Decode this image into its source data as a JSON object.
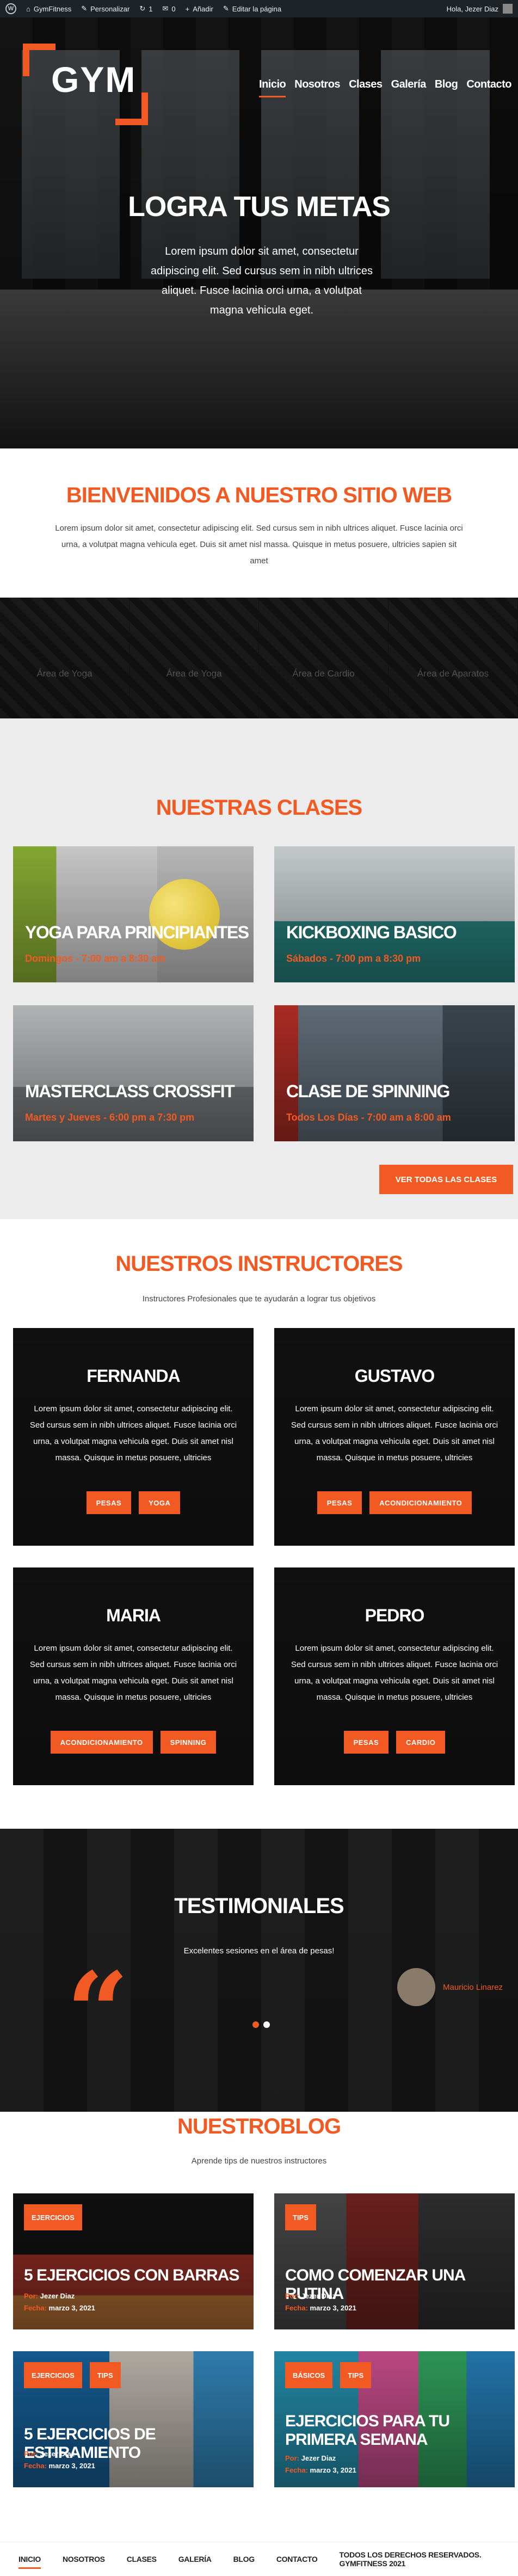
{
  "adminbar": {
    "site": "GymFitness",
    "customize": "Personalizar",
    "updates": "1",
    "comments": "0",
    "new": "Añadir",
    "edit": "Editar la página",
    "greeting": "Hola, Jezer Diaz"
  },
  "logo": {
    "text": "GYM"
  },
  "nav": [
    "Inicio",
    "Nosotros",
    "Clases",
    "Galería",
    "Blog",
    "Contacto"
  ],
  "hero": {
    "title": "LOGRA TUS METAS",
    "text": "Lorem ipsum dolor sit amet, consectetur adipiscing elit. Sed cursus sem in nibh ultrices aliquet. Fusce lacinia orci urna, a volutpat magna vehicula eget."
  },
  "welcome": {
    "title": "BIENVENIDOS A NUESTRO SITIO WEB",
    "text": "Lorem ipsum dolor sit amet, consectetur adipiscing elit. Sed cursus sem in nibh ultrices aliquet. Fusce lacinia orci urna, a volutpat magna vehicula eget. Duis sit amet nisl massa. Quisque in metus posuere, ultricies sapien sit amet"
  },
  "areas": [
    "Área de Yoga",
    "Área de Yoga",
    "Área de Cardio",
    "Área de Aparatos"
  ],
  "classes": {
    "title": "NUESTRAS CLASES",
    "items": [
      {
        "name": "YOGA PARA PRINCIPIANTES",
        "schedule": "Domingos - 7:00 am a 8:30 am"
      },
      {
        "name": "KICKBOXING BASICO",
        "schedule": "Sábados - 7:00 pm a 8:30 pm"
      },
      {
        "name": "MASTERCLASS CROSSFIT",
        "schedule": "Martes y Jueves - 6:00 pm a 7:30 pm"
      },
      {
        "name": "CLASE DE SPINNING",
        "schedule": "Todos Los Días - 7:00 am a 8:00 am"
      }
    ],
    "button": "VER TODAS LAS CLASES"
  },
  "instructors": {
    "title": "NUESTROS INSTRUCTORES",
    "subtitle": "Instructores Profesionales que te ayudarán a lograr tus objetivos",
    "items": [
      {
        "name": "FERNANDA",
        "text": "Lorem ipsum dolor sit amet, consectetur adipiscing elit. Sed cursus sem in nibh ultrices aliquet. Fusce lacinia orci urna, a volutpat magna vehicula eget. Duis sit amet nisl massa. Quisque in metus posuere, ultricies",
        "tags": [
          "PESAS",
          "YOGA"
        ]
      },
      {
        "name": "GUSTAVO",
        "text": "Lorem ipsum dolor sit amet, consectetur adipiscing elit. Sed cursus sem in nibh ultrices aliquet. Fusce lacinia orci urna, a volutpat magna vehicula eget. Duis sit amet nisl massa. Quisque in metus posuere, ultricies",
        "tags": [
          "PESAS",
          "ACONDICIONAMIENTO"
        ]
      },
      {
        "name": "MARIA",
        "text": "Lorem ipsum dolor sit amet, consectetur adipiscing elit. Sed cursus sem in nibh ultrices aliquet. Fusce lacinia orci urna, a volutpat magna vehicula eget. Duis sit amet nisl massa. Quisque in metus posuere, ultricies",
        "tags": [
          "ACONDICIONAMIENTO",
          "SPINNING"
        ]
      },
      {
        "name": "PEDRO",
        "text": "Lorem ipsum dolor sit amet, consectetur adipiscing elit. Sed cursus sem in nibh ultrices aliquet. Fusce lacinia orci urna, a volutpat magna vehicula eget. Duis sit amet nisl massa. Quisque in metus posuere, ultricies",
        "tags": [
          "PESAS",
          "CARDIO"
        ]
      }
    ]
  },
  "testimonials": {
    "title": "TESTIMONIALES",
    "message": "Excelentes sesiones en el área de pesas!",
    "author": "Mauricio Linarez"
  },
  "blog": {
    "title": "NUESTROBLOG",
    "subtitle": "Aprende tips de nuestros instructores",
    "by_label": "Por:",
    "date_label": "Fecha:",
    "posts": [
      {
        "cats": [
          "EJERCICIOS"
        ],
        "title": "5 EJERCICIOS CON BARRAS",
        "author": "Jezer Diaz",
        "date": "marzo 3, 2021"
      },
      {
        "cats": [
          "TIPS"
        ],
        "title": "COMO COMENZAR UNA RUTINA",
        "author": "Jezer Diaz",
        "date": "marzo 3, 2021"
      },
      {
        "cats": [
          "EJERCICIOS",
          "TIPS"
        ],
        "title": "5 EJERCICIOS DE ESTIRAMIENTO",
        "author": "Jezer Diaz",
        "date": "marzo 3, 2021"
      },
      {
        "cats": [
          "BÁSICOS",
          "TIPS"
        ],
        "title": "EJERCICIOS PARA TU PRIMERA SEMANA",
        "author": "Jezer Diaz",
        "date": "marzo 3, 2021"
      }
    ]
  },
  "footer": {
    "nav": [
      "INICIO",
      "NOSOTROS",
      "CLASES",
      "GALERÍA",
      "BLOG",
      "CONTACTO"
    ],
    "copyright": "TODOS LOS DERECHOS RESERVADOS. GYMFITNESS 2021"
  },
  "colors": {
    "accent": "#f15a22",
    "adminbar": "#1d2327",
    "section_gray": "#ececec"
  }
}
